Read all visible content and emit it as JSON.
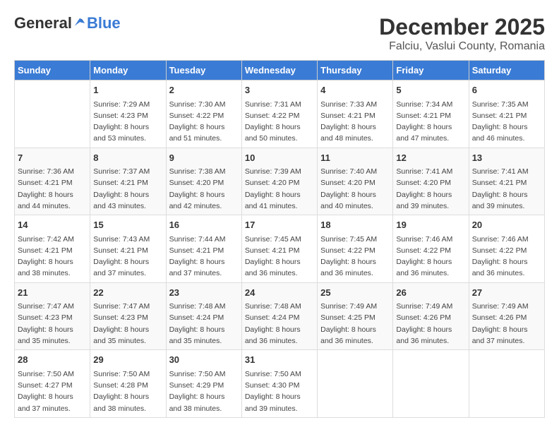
{
  "logo": {
    "general": "General",
    "blue": "Blue"
  },
  "title": "December 2025",
  "subtitle": "Falciu, Vaslui County, Romania",
  "weekdays": [
    "Sunday",
    "Monday",
    "Tuesday",
    "Wednesday",
    "Thursday",
    "Friday",
    "Saturday"
  ],
  "weeks": [
    [
      {
        "day": "",
        "info": ""
      },
      {
        "day": "1",
        "info": "Sunrise: 7:29 AM\nSunset: 4:23 PM\nDaylight: 8 hours\nand 53 minutes."
      },
      {
        "day": "2",
        "info": "Sunrise: 7:30 AM\nSunset: 4:22 PM\nDaylight: 8 hours\nand 51 minutes."
      },
      {
        "day": "3",
        "info": "Sunrise: 7:31 AM\nSunset: 4:22 PM\nDaylight: 8 hours\nand 50 minutes."
      },
      {
        "day": "4",
        "info": "Sunrise: 7:33 AM\nSunset: 4:21 PM\nDaylight: 8 hours\nand 48 minutes."
      },
      {
        "day": "5",
        "info": "Sunrise: 7:34 AM\nSunset: 4:21 PM\nDaylight: 8 hours\nand 47 minutes."
      },
      {
        "day": "6",
        "info": "Sunrise: 7:35 AM\nSunset: 4:21 PM\nDaylight: 8 hours\nand 46 minutes."
      }
    ],
    [
      {
        "day": "7",
        "info": "Sunrise: 7:36 AM\nSunset: 4:21 PM\nDaylight: 8 hours\nand 44 minutes."
      },
      {
        "day": "8",
        "info": "Sunrise: 7:37 AM\nSunset: 4:21 PM\nDaylight: 8 hours\nand 43 minutes."
      },
      {
        "day": "9",
        "info": "Sunrise: 7:38 AM\nSunset: 4:20 PM\nDaylight: 8 hours\nand 42 minutes."
      },
      {
        "day": "10",
        "info": "Sunrise: 7:39 AM\nSunset: 4:20 PM\nDaylight: 8 hours\nand 41 minutes."
      },
      {
        "day": "11",
        "info": "Sunrise: 7:40 AM\nSunset: 4:20 PM\nDaylight: 8 hours\nand 40 minutes."
      },
      {
        "day": "12",
        "info": "Sunrise: 7:41 AM\nSunset: 4:20 PM\nDaylight: 8 hours\nand 39 minutes."
      },
      {
        "day": "13",
        "info": "Sunrise: 7:41 AM\nSunset: 4:21 PM\nDaylight: 8 hours\nand 39 minutes."
      }
    ],
    [
      {
        "day": "14",
        "info": "Sunrise: 7:42 AM\nSunset: 4:21 PM\nDaylight: 8 hours\nand 38 minutes."
      },
      {
        "day": "15",
        "info": "Sunrise: 7:43 AM\nSunset: 4:21 PM\nDaylight: 8 hours\nand 37 minutes."
      },
      {
        "day": "16",
        "info": "Sunrise: 7:44 AM\nSunset: 4:21 PM\nDaylight: 8 hours\nand 37 minutes."
      },
      {
        "day": "17",
        "info": "Sunrise: 7:45 AM\nSunset: 4:21 PM\nDaylight: 8 hours\nand 36 minutes."
      },
      {
        "day": "18",
        "info": "Sunrise: 7:45 AM\nSunset: 4:22 PM\nDaylight: 8 hours\nand 36 minutes."
      },
      {
        "day": "19",
        "info": "Sunrise: 7:46 AM\nSunset: 4:22 PM\nDaylight: 8 hours\nand 36 minutes."
      },
      {
        "day": "20",
        "info": "Sunrise: 7:46 AM\nSunset: 4:22 PM\nDaylight: 8 hours\nand 36 minutes."
      }
    ],
    [
      {
        "day": "21",
        "info": "Sunrise: 7:47 AM\nSunset: 4:23 PM\nDaylight: 8 hours\nand 35 minutes."
      },
      {
        "day": "22",
        "info": "Sunrise: 7:47 AM\nSunset: 4:23 PM\nDaylight: 8 hours\nand 35 minutes."
      },
      {
        "day": "23",
        "info": "Sunrise: 7:48 AM\nSunset: 4:24 PM\nDaylight: 8 hours\nand 35 minutes."
      },
      {
        "day": "24",
        "info": "Sunrise: 7:48 AM\nSunset: 4:24 PM\nDaylight: 8 hours\nand 36 minutes."
      },
      {
        "day": "25",
        "info": "Sunrise: 7:49 AM\nSunset: 4:25 PM\nDaylight: 8 hours\nand 36 minutes."
      },
      {
        "day": "26",
        "info": "Sunrise: 7:49 AM\nSunset: 4:26 PM\nDaylight: 8 hours\nand 36 minutes."
      },
      {
        "day": "27",
        "info": "Sunrise: 7:49 AM\nSunset: 4:26 PM\nDaylight: 8 hours\nand 37 minutes."
      }
    ],
    [
      {
        "day": "28",
        "info": "Sunrise: 7:50 AM\nSunset: 4:27 PM\nDaylight: 8 hours\nand 37 minutes."
      },
      {
        "day": "29",
        "info": "Sunrise: 7:50 AM\nSunset: 4:28 PM\nDaylight: 8 hours\nand 38 minutes."
      },
      {
        "day": "30",
        "info": "Sunrise: 7:50 AM\nSunset: 4:29 PM\nDaylight: 8 hours\nand 38 minutes."
      },
      {
        "day": "31",
        "info": "Sunrise: 7:50 AM\nSunset: 4:30 PM\nDaylight: 8 hours\nand 39 minutes."
      },
      {
        "day": "",
        "info": ""
      },
      {
        "day": "",
        "info": ""
      },
      {
        "day": "",
        "info": ""
      }
    ]
  ]
}
